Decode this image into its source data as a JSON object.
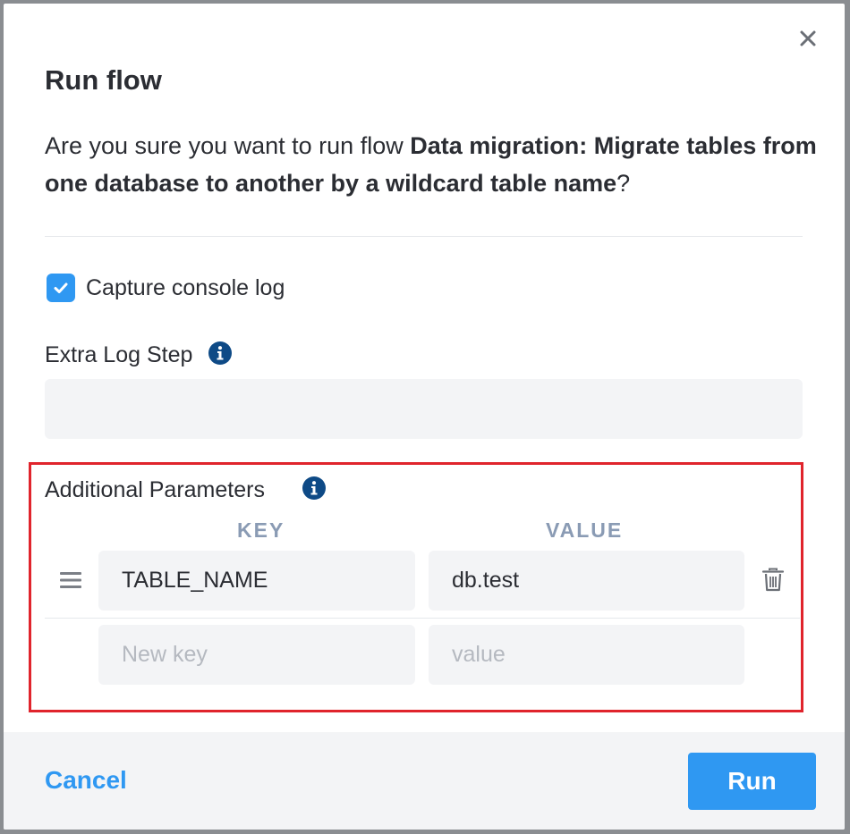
{
  "modal": {
    "title": "Run flow",
    "question": {
      "prefix": "Are you sure you want to run flow ",
      "flow_name": "Data migration: Migrate tables from one database to another by a wildcard table name",
      "suffix": "?"
    }
  },
  "capture_console_log": {
    "label": "Capture console log",
    "checked": true
  },
  "extra_log_step": {
    "label": "Extra Log Step",
    "value": ""
  },
  "additional_parameters": {
    "label": "Additional Parameters",
    "key_header": "KEY",
    "value_header": "VALUE",
    "rows": [
      {
        "key": "TABLE_NAME",
        "value": "db.test"
      }
    ],
    "new_row": {
      "key_placeholder": "New key",
      "value_placeholder": "value"
    }
  },
  "footer": {
    "cancel_label": "Cancel",
    "run_label": "Run"
  },
  "colors": {
    "accent": "#2f98f2",
    "info_icon": "#0e4a86",
    "highlight": "#e0242c"
  },
  "icons": {
    "close": "close-icon",
    "check": "check-icon",
    "info": "info-icon",
    "drag": "drag-handle-icon",
    "trash": "trash-icon"
  }
}
